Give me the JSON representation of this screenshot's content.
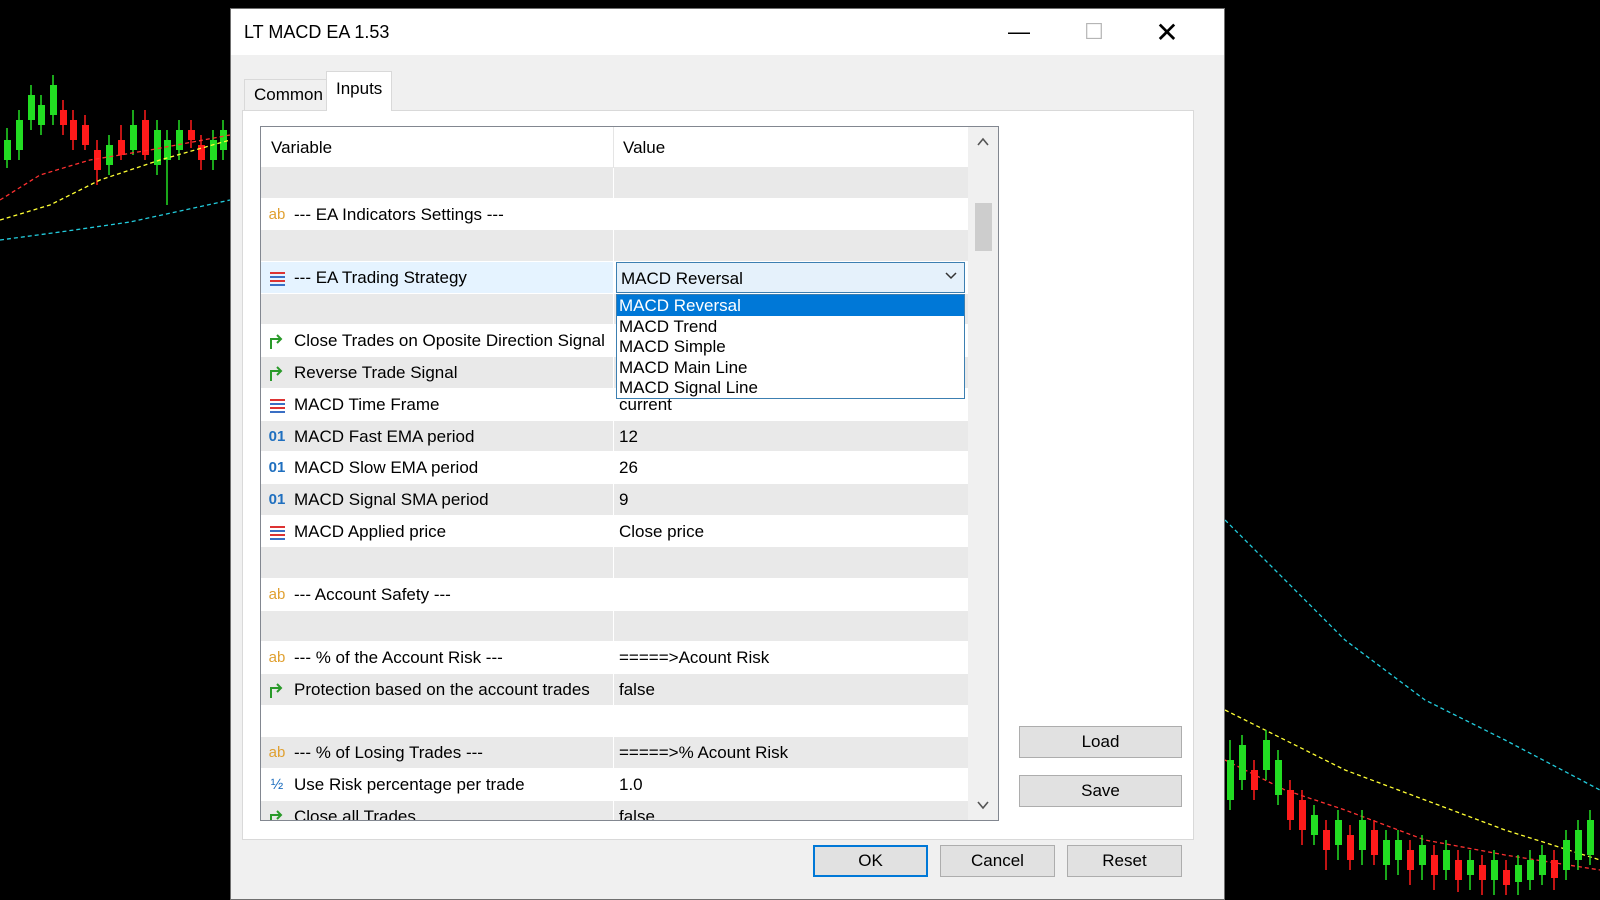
{
  "window": {
    "title": "LT MACD EA 1.53",
    "minimize_glyph": "—",
    "maximize_glyph": "☐",
    "close_glyph": "✕"
  },
  "tabs": [
    {
      "label": "Common",
      "active": false
    },
    {
      "label": "Inputs",
      "active": true
    }
  ],
  "grid": {
    "headers": {
      "variable": "Variable",
      "value": "Value"
    },
    "rows": [
      {
        "icon": "",
        "variable": "",
        "value": "",
        "shade": "gray"
      },
      {
        "icon": "ab-icon",
        "variable": "--- EA Indicators Settings ---",
        "value": "",
        "shade": "white"
      },
      {
        "icon": "",
        "variable": "",
        "value": "",
        "shade": "gray"
      },
      {
        "icon": "enum-icon",
        "variable": "--- EA Trading Strategy",
        "value": "MACD Reversal",
        "shade": "white",
        "selected": true
      },
      {
        "icon": "",
        "variable": "",
        "value": "",
        "shade": "gray"
      },
      {
        "icon": "bool-icon",
        "variable": "Close Trades on Oposite Direction Signal",
        "value": "",
        "shade": "white"
      },
      {
        "icon": "bool-icon",
        "variable": "Reverse Trade Signal",
        "value": "",
        "shade": "gray"
      },
      {
        "icon": "enum-icon",
        "variable": "MACD Time Frame",
        "value": "current",
        "shade": "white"
      },
      {
        "icon": "int-icon",
        "variable": "MACD Fast EMA period",
        "value": "12",
        "shade": "gray"
      },
      {
        "icon": "int-icon",
        "variable": "MACD Slow EMA period",
        "value": "26",
        "shade": "white"
      },
      {
        "icon": "int-icon",
        "variable": "MACD Signal SMA period",
        "value": "9",
        "shade": "gray"
      },
      {
        "icon": "enum-icon",
        "variable": "MACD Applied price",
        "value": "Close price",
        "shade": "white"
      },
      {
        "icon": "",
        "variable": "",
        "value": "",
        "shade": "gray"
      },
      {
        "icon": "ab-icon",
        "variable": "--- Account Safety ---",
        "value": "",
        "shade": "white"
      },
      {
        "icon": "",
        "variable": "",
        "value": "",
        "shade": "gray"
      },
      {
        "icon": "ab-icon",
        "variable": "--- % of the Account Risk ---",
        "value": "=====>Acount Risk",
        "shade": "white"
      },
      {
        "icon": "bool-icon",
        "variable": "Protection based on the account trades",
        "value": "false",
        "shade": "gray"
      },
      {
        "icon": "",
        "variable": "",
        "value": "",
        "shade": "white"
      },
      {
        "icon": "ab-icon",
        "variable": "--- % of Losing Trades ---",
        "value": "=====>% Acount Risk",
        "shade": "gray"
      },
      {
        "icon": "double-icon",
        "variable": "Use Risk percentage per trade",
        "value": "1.0",
        "shade": "white"
      },
      {
        "icon": "bool-icon",
        "variable": "Close all Trades",
        "value": "false",
        "shade": "gray"
      }
    ],
    "icon_glyphs": {
      "ab-icon": "ab",
      "int-icon": "01",
      "double-icon": "½",
      "bool-icon": "↱",
      "enum-icon": ""
    }
  },
  "dropdown": {
    "selected": "MACD Reversal",
    "options": [
      "MACD Reversal",
      "MACD Trend",
      "MACD Simple",
      "MACD Main Line",
      "MACD Signal Line"
    ]
  },
  "scrollbar": {
    "up_glyph": "^",
    "down_glyph": "v"
  },
  "side_buttons": {
    "load": "Load",
    "save": "Save"
  },
  "footer_buttons": {
    "ok": "OK",
    "cancel": "Cancel",
    "reset": "Reset"
  },
  "colors": {
    "bull_candle": "#22dd22",
    "bear_candle": "#ff1a1a",
    "ma_red": "#ff3030",
    "ma_yellow": "#ffff33",
    "ma_cyan": "#22ccdd",
    "accent": "#0078d7"
  }
}
